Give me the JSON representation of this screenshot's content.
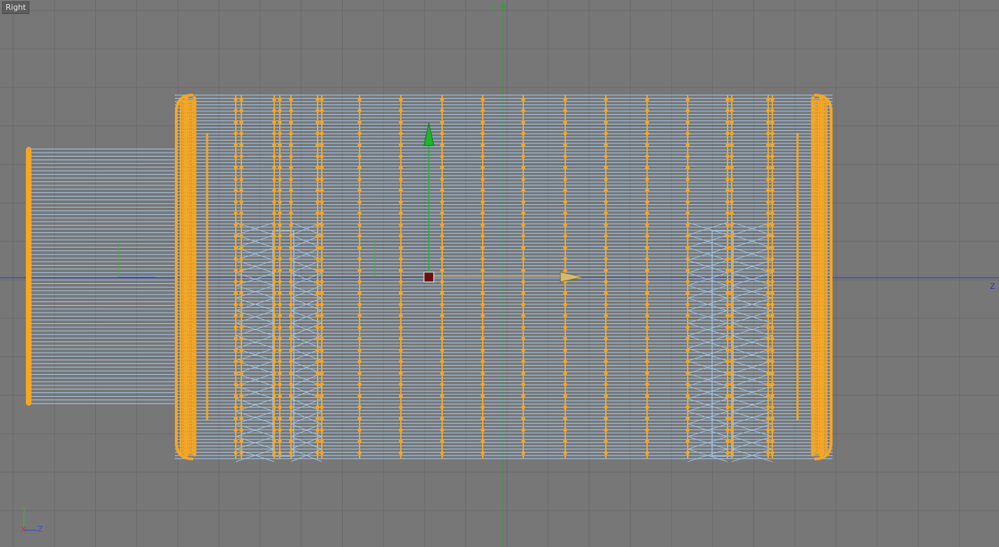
{
  "viewport": {
    "view_label": "Right",
    "axis_y_label": "Y",
    "axis_z_label": "Z",
    "colors": {
      "background": "#777777",
      "grid": "#6a6a6a",
      "wire": "#a6ccf0",
      "vertex": "#f5a623",
      "y_axis": "#3fa33f",
      "z_axis": "#2b3bb8",
      "gizmo_y": "#1fb52f",
      "gizmo_z": "#c9b06a",
      "gizmo_center": "#6b1010"
    }
  },
  "axis_indicator": {
    "y_label": "Y",
    "z_label": "Z",
    "x_label": "X"
  },
  "icons": {
    "move_y": "arrow-up-icon",
    "move_z": "arrow-right-icon",
    "pivot": "pivot-icon"
  }
}
